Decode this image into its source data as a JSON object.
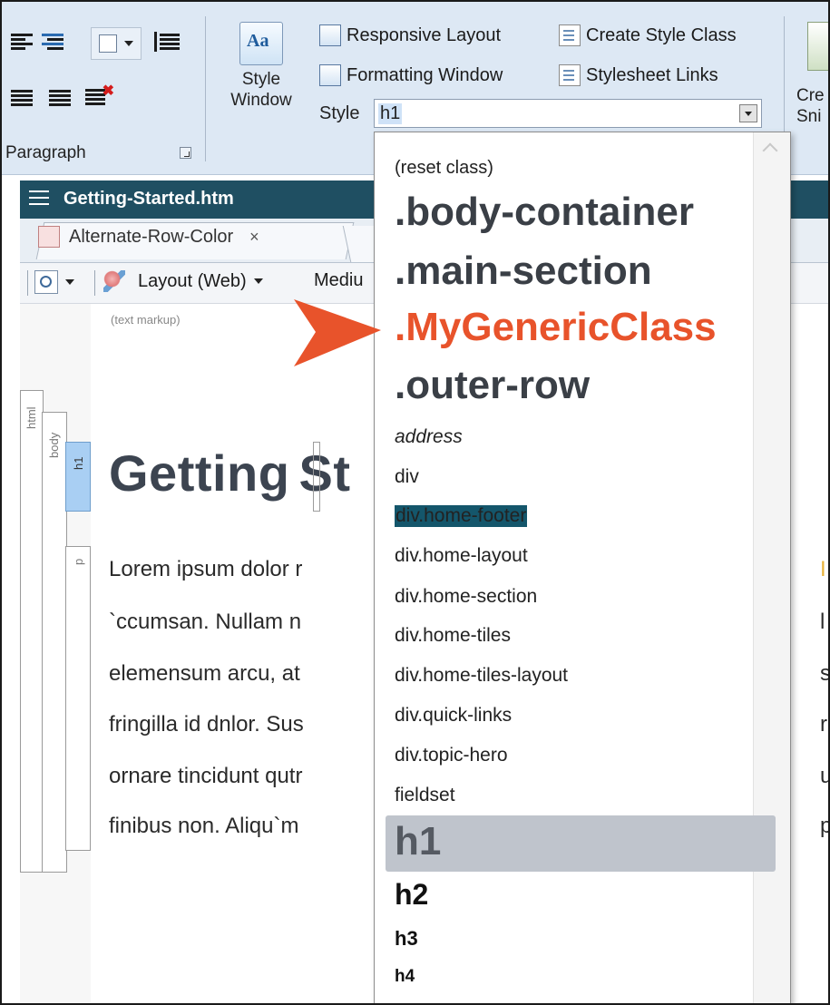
{
  "ribbon": {
    "paragraph_group_label": "Paragraph",
    "style_window_label_1": "Style",
    "style_window_label_2": "Window",
    "commands": {
      "responsive_layout": "Responsive Layout",
      "formatting_window": "Formatting Window",
      "create_style_class": "Create Style Class",
      "stylesheet_links": "Stylesheet Links"
    },
    "style_label": "Style",
    "style_value": "h1",
    "cut_off_label_1": "Cre",
    "cut_off_label_2": "Sni"
  },
  "document": {
    "title": "Getting-Started.htm",
    "tab_label": "Alternate-Row-Color",
    "tab_close": "×",
    "layout_label": "Layout (Web)",
    "medium_label": "Mediu",
    "text_markup": "(text markup)",
    "structure_bars": [
      "html",
      "body",
      "h1",
      "p"
    ],
    "heading_visible": "Getting",
    "heading_after_caret": "St",
    "paragraph_lines": [
      "Lorem ipsum dolor r",
      "`ccumsan. Nullam n",
      "elemensum arcu, at",
      "fringilla id dnlor. Sus",
      "ornare tincidunt qutr",
      "finibus non. Aliqu`m"
    ],
    "right_fragments": [
      "I",
      "l",
      "s",
      "r",
      "u",
      "p"
    ]
  },
  "dropdown": {
    "items": [
      {
        "label": "(reset class)",
        "style": "small"
      },
      {
        "label": ".body-container",
        "style": "big"
      },
      {
        "label": ".main-section",
        "style": "big"
      },
      {
        "label": ".MyGenericClass",
        "style": "big-accent"
      },
      {
        "label": ".outer-row",
        "style": "big"
      },
      {
        "label": "address",
        "style": "italic"
      },
      {
        "label": "div",
        "style": "small"
      },
      {
        "label": "div.home-footer",
        "style": "highlighted"
      },
      {
        "label": "div.home-layout",
        "style": "small"
      },
      {
        "label": "div.home-section",
        "style": "small"
      },
      {
        "label": "div.home-tiles",
        "style": "small"
      },
      {
        "label": "div.home-tiles-layout",
        "style": "small"
      },
      {
        "label": "div.quick-links",
        "style": "small"
      },
      {
        "label": "div.topic-hero",
        "style": "small"
      },
      {
        "label": "fieldset",
        "style": "small"
      },
      {
        "label": "h1",
        "style": "selected"
      },
      {
        "label": "h2",
        "style": "h2"
      },
      {
        "label": "h3",
        "style": "h3"
      },
      {
        "label": "h4",
        "style": "h4"
      }
    ]
  },
  "colors": {
    "accent": "#e8532b",
    "doc_titlebar": "#1f4f62",
    "ribbon": "#dde8f4",
    "highlight": "#14566b",
    "selected_row": "#bfc4cc"
  }
}
